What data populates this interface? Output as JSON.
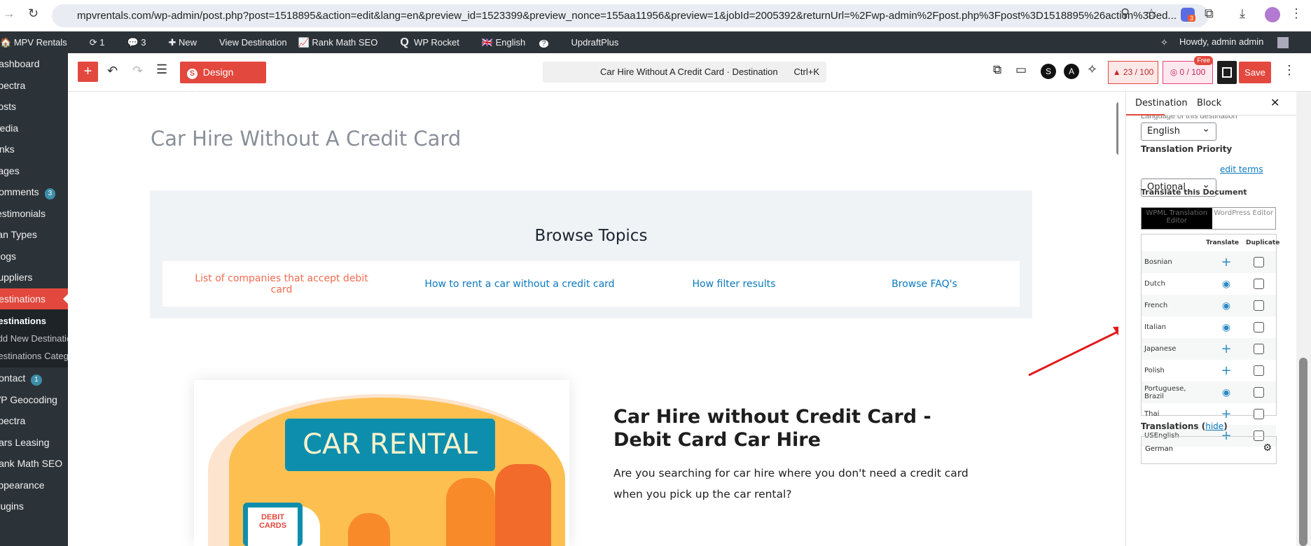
{
  "browser": {
    "url": "mpvrentals.com/wp-admin/post.php?post=1518895&action=edit&lang=en&preview_id=1523399&preview_nonce=155aa11956&preview=1&jobId=2005392&returnUrl=%2Fwp-admin%2Fpost.php%3Fpost%3D1518895%26action%3Ded...",
    "extension_badge": "3"
  },
  "adminbar": {
    "site": "MPV Rentals",
    "updates": "1",
    "comments": "3",
    "new": "New",
    "view": "View Destination",
    "rankmath": "Rank Math SEO",
    "rocket": "WP Rocket",
    "language": "English",
    "updraft": "UpdraftPlus",
    "howdy": "Howdy, admin admin"
  },
  "sidebar": {
    "items": [
      {
        "label": "Dashboard"
      },
      {
        "label": "Spectra"
      },
      {
        "label": "Posts"
      },
      {
        "label": "Media"
      },
      {
        "label": "Links"
      },
      {
        "label": "Pages"
      },
      {
        "label": "Comments",
        "badge": "3"
      },
      {
        "label": "Testimonials"
      },
      {
        "label": "Van Types"
      },
      {
        "label": "Blogs"
      },
      {
        "label": "Suppliers"
      },
      {
        "label": "Destinations"
      }
    ],
    "submenu": [
      "Destinations",
      "Add New Destination",
      "Destinations Categories"
    ],
    "items2": [
      {
        "label": "Contact",
        "badge": "1"
      },
      {
        "label": "WP Geocoding"
      },
      {
        "label": "Spectra"
      },
      {
        "label": "Cars Leasing"
      },
      {
        "label": "Rank Math SEO"
      },
      {
        "label": "Appearance"
      },
      {
        "label": "Plugins"
      }
    ]
  },
  "toolbar": {
    "design_library": "Design Library",
    "command": "Car Hire Without A Credit Card · Destination",
    "shortcut": "Ctrl+K",
    "seo_score": "23 / 100",
    "ai_score": "0 / 100",
    "free_badge": "Free",
    "save": "Save"
  },
  "content": {
    "title": "Car Hire Without A Credit Card",
    "browse_heading": "Browse Topics",
    "topics": [
      "List of companies that accept debit card",
      "How to rent a car without a credit card",
      "How filter results",
      "Browse FAQ's"
    ],
    "image_text": {
      "sign": "CAR RENTAL",
      "card": "DEBIT CARDS"
    },
    "heading": "Car Hire without Credit Card - Debit Card Car Hire",
    "paragraph": "Are you searching for car hire where you don't need a credit card when you pick up the car rental?"
  },
  "panel": {
    "tabs": [
      "Destination",
      "Block"
    ],
    "language_label": "Language of this destination",
    "language": "English",
    "priority_label": "Translation Priority",
    "priority": "Optional",
    "edit_terms": "edit terms",
    "translate_label": "Translate this Document",
    "editor_options": [
      "WPML Translation Editor",
      "WordPress Editor"
    ],
    "col_translate": "Translate",
    "col_duplicate": "Duplicate",
    "languages": [
      {
        "name": "Bosnian",
        "status": "add"
      },
      {
        "name": "Dutch",
        "status": "view"
      },
      {
        "name": "French",
        "status": "view"
      },
      {
        "name": "Italian",
        "status": "view"
      },
      {
        "name": "Japanese",
        "status": "add"
      },
      {
        "name": "Polish",
        "status": "add"
      },
      {
        "name": "Portuguese, Brazil",
        "status": "view"
      },
      {
        "name": "Thai",
        "status": "add"
      },
      {
        "name": "USEnglish",
        "status": "add"
      }
    ],
    "translations_label": "Translations",
    "hide": "hide",
    "translations": [
      "German"
    ]
  },
  "colors": {
    "accent": "#e2483d",
    "link": "#0a7abf",
    "topic_active": "#f26b50"
  }
}
